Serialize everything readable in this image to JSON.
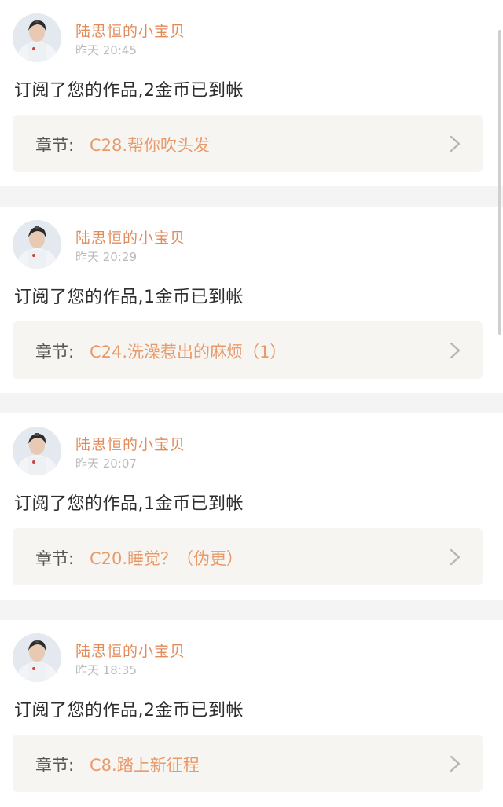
{
  "notifications": [
    {
      "username": "陆思恒的小宝贝",
      "timestamp": "昨天 20:45",
      "message": "订阅了您的作品,2金币已到帐",
      "chapter_label": "章节:",
      "chapter_title": "C28.帮你吹头发"
    },
    {
      "username": "陆思恒的小宝贝",
      "timestamp": "昨天 20:29",
      "message": "订阅了您的作品,1金币已到帐",
      "chapter_label": "章节:",
      "chapter_title": "C24.洗澡惹出的麻烦（1）"
    },
    {
      "username": "陆思恒的小宝贝",
      "timestamp": "昨天 20:07",
      "message": "订阅了您的作品,1金币已到帐",
      "chapter_label": "章节:",
      "chapter_title": "C20.睡觉？（伪更）"
    },
    {
      "username": "陆思恒的小宝贝",
      "timestamp": "昨天 18:35",
      "message": "订阅了您的作品,2金币已到帐",
      "chapter_label": "章节:",
      "chapter_title": "C8.踏上新征程"
    }
  ],
  "icons": {
    "chevron": "chevron-right-icon",
    "avatar": "user-avatar"
  },
  "colors": {
    "username": "#e38a59",
    "chapter_title": "#e99a6b",
    "timestamp": "#b9b9b9",
    "chapter_box_bg": "#f6f5f1",
    "page_bg": "#f4f4f4"
  }
}
